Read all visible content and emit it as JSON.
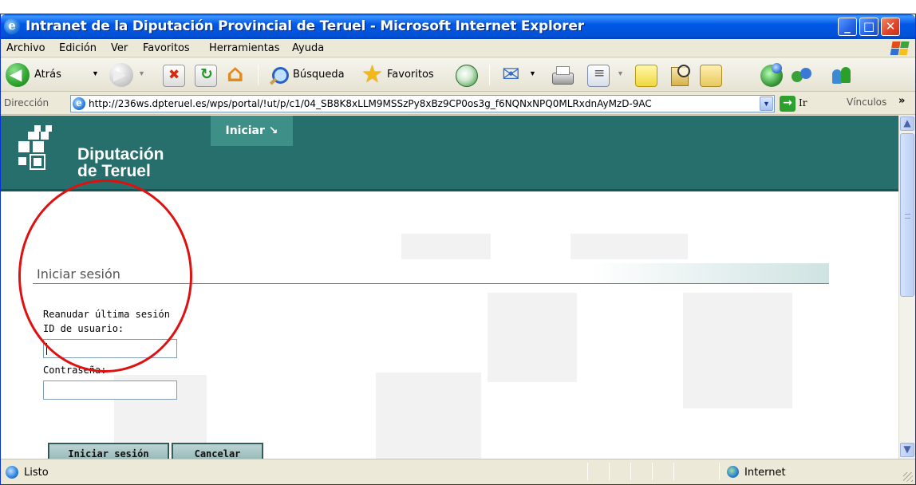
{
  "window": {
    "title": "Intranet de la Diputación Provincial de Teruel - Microsoft Internet Explorer",
    "controls": {
      "minimize": "_",
      "maximize": "□",
      "close": "✕"
    }
  },
  "menu": [
    "Archivo",
    "Edición",
    "Ver",
    "Favoritos",
    "Herramientas",
    "Ayuda"
  ],
  "toolbar": {
    "back_label": "Atrás",
    "search_label": "Búsqueda",
    "favorites_label": "Favoritos"
  },
  "address": {
    "label": "Dirección",
    "url": "http://236ws.dpteruel.es/wps/portal/!ut/p/c1/04_SB8K8xLLM9MSSzPy8xBz9CP0os3g_f6NQNxNPQ0MLRxdnAyMzD-9AC",
    "go_label": "Ir",
    "links_label": "Vínculos"
  },
  "page": {
    "logo_line1": "Diputación",
    "logo_line2": "de Teruel",
    "tab_label": "Iniciar ↘",
    "section_title": "Iniciar sesión",
    "resume_text": "Reanudar última sesión",
    "user_label": "ID de usuario:",
    "user_value": "",
    "password_label": "Contraseña:",
    "password_value": "",
    "login_button": "Iniciar sesión",
    "cancel_button": "Cancelar"
  },
  "status": {
    "text": "Listo",
    "zone": "Internet"
  },
  "colors": {
    "banner": "#276f6c",
    "tab": "#3f8f89",
    "annotation_ring": "#e01010"
  }
}
